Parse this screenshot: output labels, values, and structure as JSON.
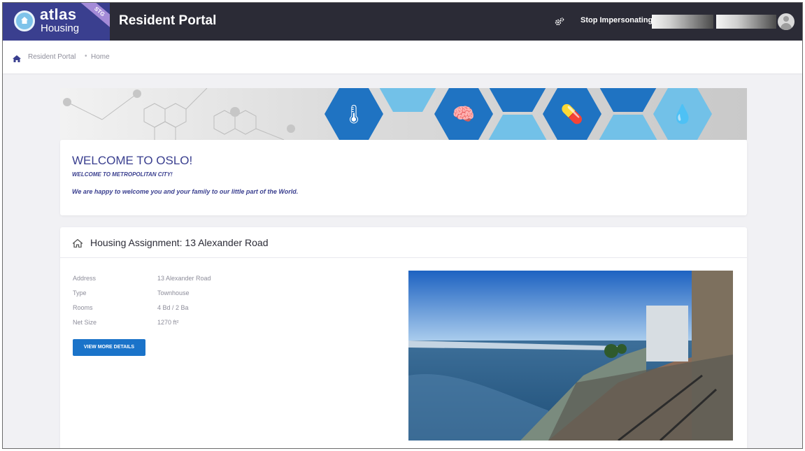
{
  "brand": {
    "name": "atlas",
    "subname": "Housing",
    "env_badge": "STG"
  },
  "header": {
    "title": "Resident Portal",
    "stop_impersonating": "Stop Impersonating"
  },
  "breadcrumb": {
    "items": [
      "Resident Portal",
      "Home"
    ],
    "separator": "•"
  },
  "welcome": {
    "title": "WELCOME TO OSLO!",
    "subtitle": "WELCOME TO METROPOLITAN CITY!",
    "message": "We are happy to welcome you and your family to our little part of the World."
  },
  "housing": {
    "title": "Housing Assignment: 13 Alexander Road",
    "details": [
      {
        "label": "Address",
        "value": "13 Alexander Road"
      },
      {
        "label": "Type",
        "value": "Townhouse"
      },
      {
        "label": "Rooms",
        "value": "4 Bd / 2 Ba"
      },
      {
        "label": "Net Size",
        "value": "1270 ft²"
      }
    ],
    "button_label": "VIEW MORE DETAILS"
  },
  "colors": {
    "topbar": "#2b2b36",
    "brand": "#3a3f8f",
    "accent": "#1a73c9",
    "hex_dark": "#1f73c2",
    "hex_light": "#72c1e8"
  },
  "icons": {
    "settings": "gears-icon",
    "home": "home-icon",
    "house": "house-icon",
    "avatar": "user-avatar-icon"
  }
}
